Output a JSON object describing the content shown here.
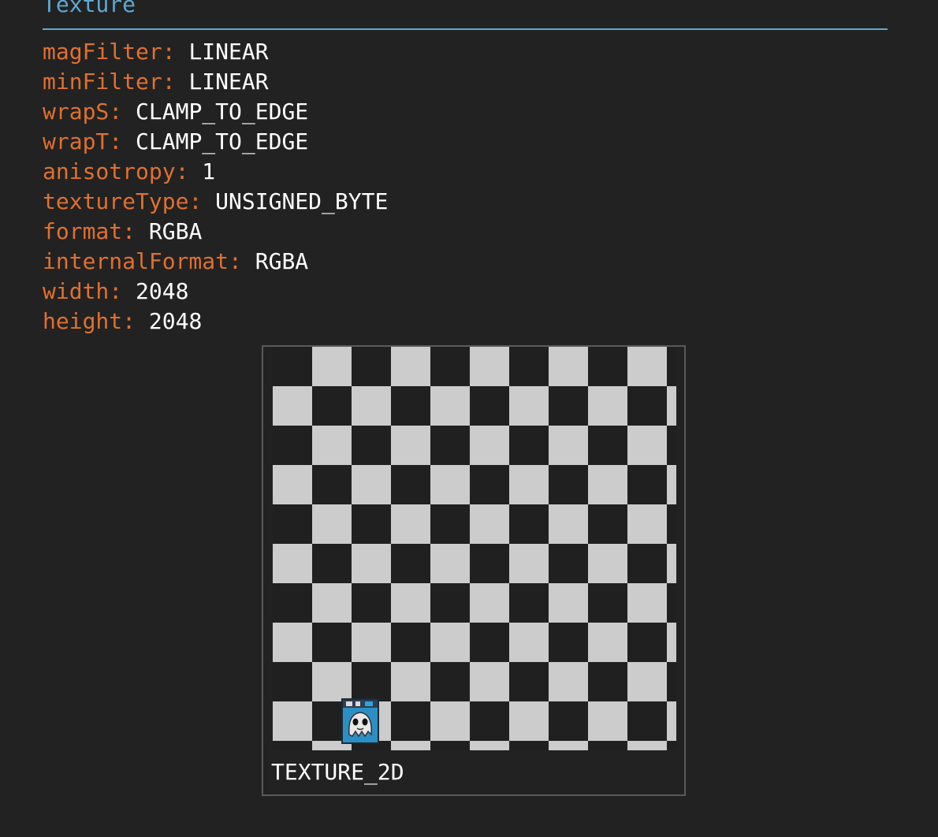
{
  "section": {
    "title": "Texture"
  },
  "properties": [
    {
      "key": "magFilter",
      "value": "LINEAR"
    },
    {
      "key": "minFilter",
      "value": "LINEAR"
    },
    {
      "key": "wrapS",
      "value": "CLAMP_TO_EDGE"
    },
    {
      "key": "wrapT",
      "value": "CLAMP_TO_EDGE"
    },
    {
      "key": "anisotropy",
      "value": "1"
    },
    {
      "key": "textureType",
      "value": "UNSIGNED_BYTE"
    },
    {
      "key": "format",
      "value": "RGBA"
    },
    {
      "key": "internalFormat",
      "value": "RGBA"
    },
    {
      "key": "width",
      "value": "2048"
    },
    {
      "key": "height",
      "value": "2048"
    }
  ],
  "texture": {
    "target": "TEXTURE_2D",
    "light_color": "#cccccc",
    "dark_color": "#202020",
    "badge_icon": "ghost-icon"
  },
  "colors": {
    "background": "#222222",
    "header": "#5fa8d3",
    "key": "#e07030",
    "value": "#ffffff"
  }
}
